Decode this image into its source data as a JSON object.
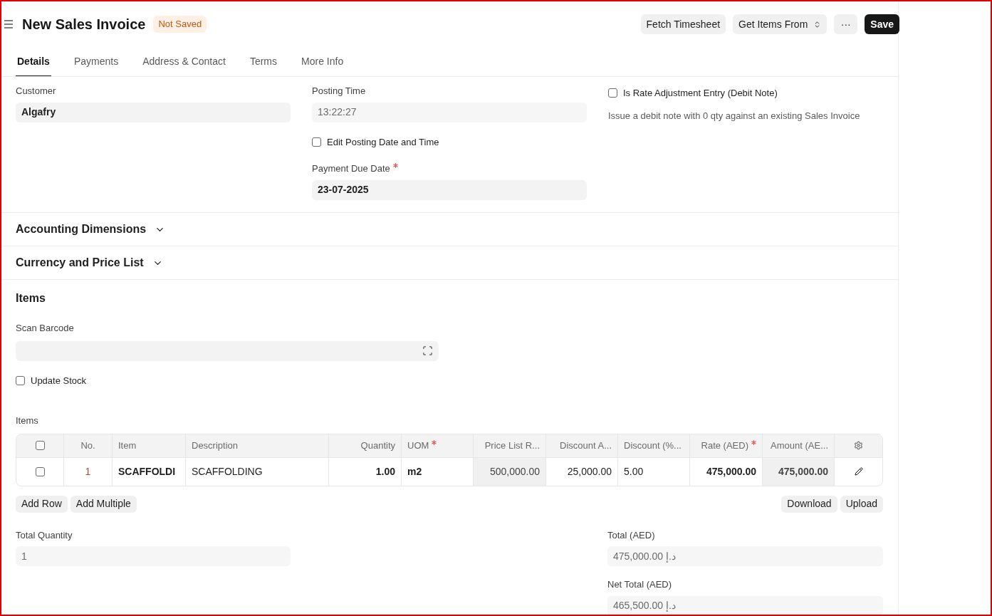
{
  "header": {
    "title": "New Sales Invoice",
    "status": "Not Saved",
    "buttons": [
      {
        "label": "Fetch Timesheet",
        "kind": "default"
      },
      {
        "label": "Get Items From",
        "kind": "dropdown"
      },
      {
        "label": "···",
        "kind": "more"
      },
      {
        "label": "Save",
        "kind": "primary"
      }
    ]
  },
  "tabs": [
    {
      "label": "Details",
      "selected": true
    },
    {
      "label": "Payments",
      "selected": false
    },
    {
      "label": "Address & Contact",
      "selected": false
    },
    {
      "label": "Terms",
      "selected": false
    },
    {
      "label": "More Info",
      "selected": false
    }
  ],
  "customer": {
    "label": "Customer",
    "value": "Algafry",
    "read_only": false
  },
  "posting_time": {
    "label": "Posting Time",
    "value": "13:22:27",
    "read_only": true
  },
  "edit_posting": {
    "label": "Edit Posting Date and Time",
    "checked": false
  },
  "payment_due_date": {
    "label": "Payment Due Date",
    "required": true,
    "value": "23-07-2025",
    "read_only": false
  },
  "rate_adjustment": {
    "label": "Is Rate Adjustment Entry (Debit Note)",
    "checked": false,
    "description": "Issue a debit note with 0 qty against an existing Sales Invoice"
  },
  "sections": [
    {
      "title": "Accounting Dimensions",
      "expanded": false
    },
    {
      "title": "Currency and Price List",
      "expanded": false
    }
  ],
  "items": {
    "title": "Items",
    "scan_barcode": {
      "label": "Scan Barcode"
    },
    "update_stock": {
      "label": "Update Stock",
      "checked": false
    },
    "table": {
      "label": "Items",
      "all_selected": false,
      "columns": [
        {
          "label": "No.",
          "required": false,
          "read_only": false
        },
        {
          "label": "Item",
          "required": false,
          "read_only": false
        },
        {
          "label": "Description",
          "required": false,
          "read_only": false
        },
        {
          "label": "Quantity",
          "required": false,
          "read_only": false
        },
        {
          "label": "UOM",
          "required": true,
          "read_only": false
        },
        {
          "label": "Price List R...",
          "required": false,
          "read_only": true
        },
        {
          "label": "Discount A...",
          "required": false,
          "read_only": false
        },
        {
          "label": "Discount (%...",
          "required": false,
          "read_only": false
        },
        {
          "label": "Rate (AED)",
          "required": true,
          "read_only": false
        },
        {
          "label": "Amount (AE...",
          "required": false,
          "read_only": true
        }
      ],
      "rows": [
        {
          "selected": false,
          "cells": [
            "1",
            "SCAFFOLDI",
            "SCAFFOLDING",
            "1.00",
            "m2",
            "500,000.00",
            "25,000.00",
            "5.00",
            "475,000.00",
            "475,000.00"
          ]
        }
      ]
    },
    "left_buttons": [
      "Add Row",
      "Add Multiple"
    ],
    "right_buttons": [
      "Download",
      "Upload"
    ]
  },
  "total_quantity": {
    "label": "Total Quantity",
    "value": "1",
    "read_only": true
  },
  "total": {
    "label": "Total (AED)",
    "value": "475,000.00 د.إ",
    "read_only": true
  },
  "net_total": {
    "label": "Net Total (AED)",
    "value": "465,500.00 د.إ",
    "read_only": true
  }
}
